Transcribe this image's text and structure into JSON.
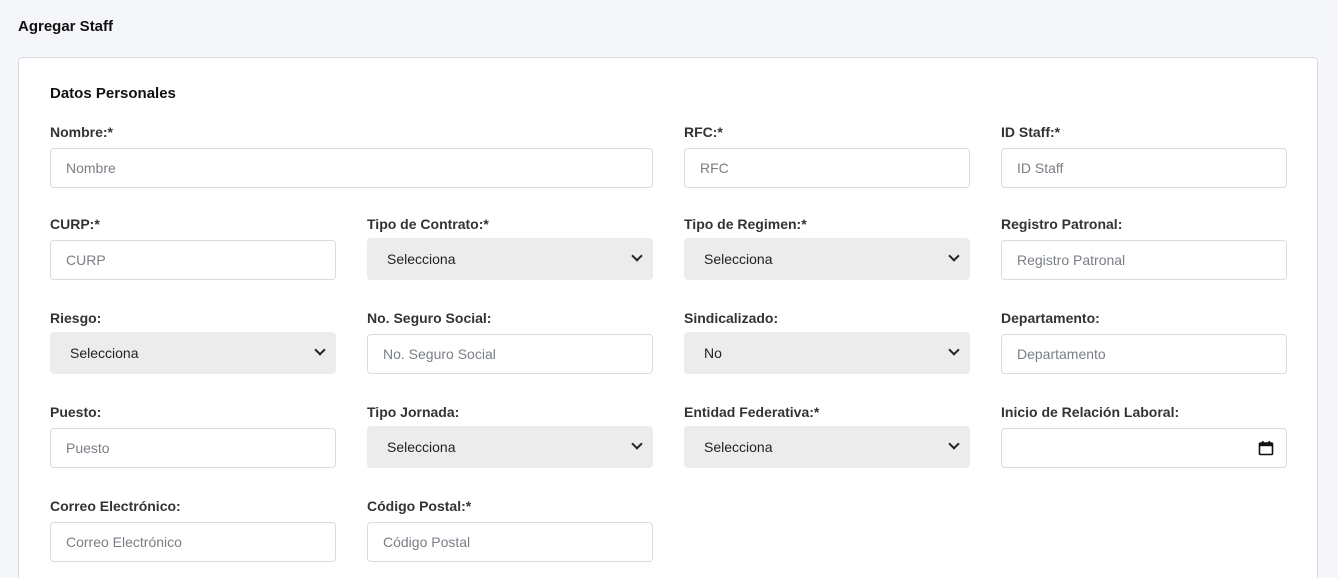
{
  "page": {
    "title": "Agregar Staff"
  },
  "section": {
    "title": "Datos Personales"
  },
  "fields": {
    "nombre": {
      "label": "Nombre:*",
      "placeholder": "Nombre"
    },
    "rfc": {
      "label": "RFC:*",
      "placeholder": "RFC"
    },
    "id_staff": {
      "label": "ID Staff:*",
      "placeholder": "ID Staff"
    },
    "curp": {
      "label": "CURP:*",
      "placeholder": "CURP"
    },
    "tipo_contrato": {
      "label": "Tipo de Contrato:*",
      "value": "Selecciona"
    },
    "tipo_regimen": {
      "label": "Tipo de Regimen:*",
      "value": "Selecciona"
    },
    "registro_patronal": {
      "label": "Registro Patronal:",
      "placeholder": "Registro Patronal"
    },
    "riesgo": {
      "label": "Riesgo:",
      "value": "Selecciona"
    },
    "seguro_social": {
      "label": "No. Seguro Social:",
      "placeholder": "No. Seguro Social"
    },
    "sindicalizado": {
      "label": "Sindicalizado:",
      "value": "No"
    },
    "departamento": {
      "label": "Departamento:",
      "placeholder": "Departamento"
    },
    "puesto": {
      "label": "Puesto:",
      "placeholder": "Puesto"
    },
    "tipo_jornada": {
      "label": "Tipo Jornada:",
      "value": "Selecciona"
    },
    "entidad_federativa": {
      "label": "Entidad Federativa:*",
      "value": "Selecciona"
    },
    "inicio_relacion": {
      "label": "Inicio de Relación Laboral:"
    },
    "correo": {
      "label": "Correo Electrónico:",
      "placeholder": "Correo Electrónico"
    },
    "codigo_postal": {
      "label": "Código Postal:*",
      "placeholder": "Código Postal"
    }
  },
  "icons": {
    "select_arrow": "chevron-down-icon",
    "date_picker": "calendar-icon"
  }
}
